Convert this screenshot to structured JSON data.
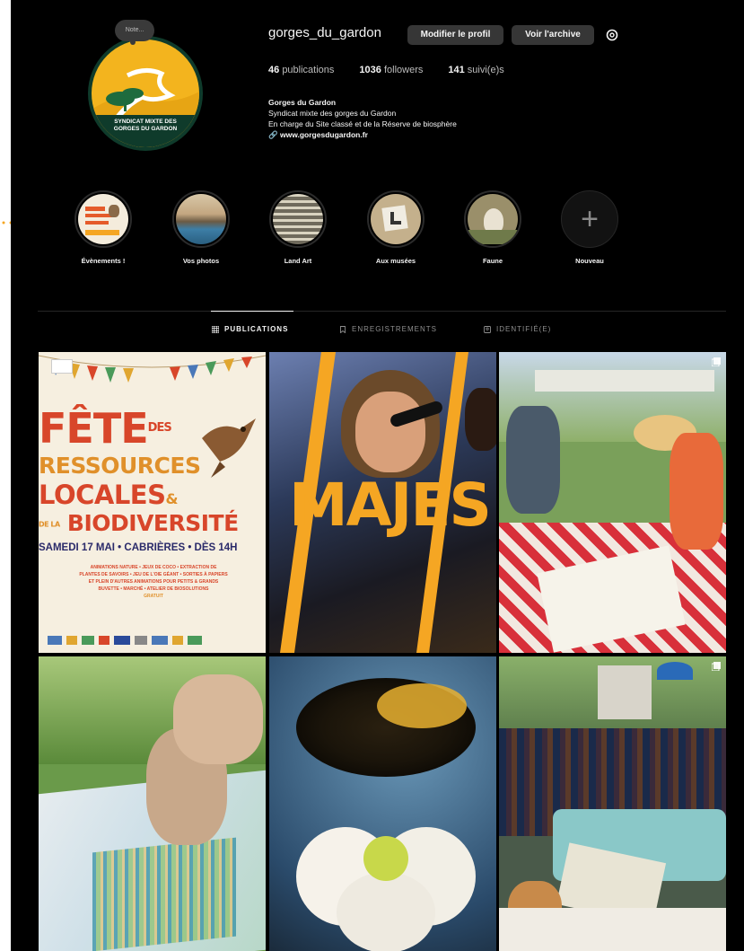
{
  "profile": {
    "username": "gorges_du_gardon",
    "note": "Note...",
    "edit_profile": "Modifier le profil",
    "view_archive": "Voir l'archive",
    "logo_lines": [
      "SYNDICAT MIXTE DES",
      "GORGES DU GARDON"
    ],
    "stats": [
      {
        "value": "46",
        "label": "publications"
      },
      {
        "value": "1036",
        "label": "followers"
      },
      {
        "value": "141",
        "label": "suivi(e)s"
      }
    ],
    "bio": {
      "name": "Gorges du Gardon",
      "line1": "Syndicat mixte des gorges du Gardon",
      "line2": "En charge du Site classé et de la Réserve de biosphère",
      "link": "www.gorgesdugardon.fr"
    }
  },
  "highlights": [
    {
      "label": "Évènements !",
      "icon": "event-poster"
    },
    {
      "label": "Vos photos",
      "icon": "landscape"
    },
    {
      "label": "Land Art",
      "icon": "land-art"
    },
    {
      "label": "Aux musées",
      "icon": "museum"
    },
    {
      "label": "Faune",
      "icon": "bird"
    },
    {
      "label": "Nouveau",
      "icon": "plus-icon"
    }
  ],
  "tabs": [
    {
      "label": "PUBLICATIONS",
      "icon": "grid-icon",
      "active": true
    },
    {
      "label": "ENREGISTREMENTS",
      "icon": "bookmark-icon",
      "active": false
    },
    {
      "label": "IDENTIFIÉ(E)",
      "icon": "tag-icon",
      "active": false
    }
  ],
  "posts": {
    "p1": {
      "line1": "FÊTE",
      "des": "DES",
      "line2": "RESSOURCES",
      "line3": "LOCALES",
      "amp": "&",
      "de_la": "DE LA",
      "line4": "BIODIVERSITÉ",
      "date": "SAMEDI 17 MAI • CABRIÈRES • DÈS 14H",
      "small1": "ANIMATIONS NATURE • JEUX DE COCO • EXTRACTION DE",
      "small2": "PLANTES DE SAVOIRS • JEU DE L'OIE GÉANT • SORTIES À PAPIERS",
      "small3": "ET PLEIN D'AUTRES ANIMATIONS POUR PETITS & GRANDS",
      "small4": "BUVETTE • MARCHÉ • ATELIER DE BIOSOLUTIONS",
      "small5": "GRATUIT"
    },
    "p2": {
      "text": "MAJES"
    }
  },
  "colors": {
    "background": "#000000",
    "button": "#363636",
    "accent_orange": "#f5a623",
    "logo_yellow": "#f3b41e",
    "logo_green": "#0f3b2b"
  }
}
